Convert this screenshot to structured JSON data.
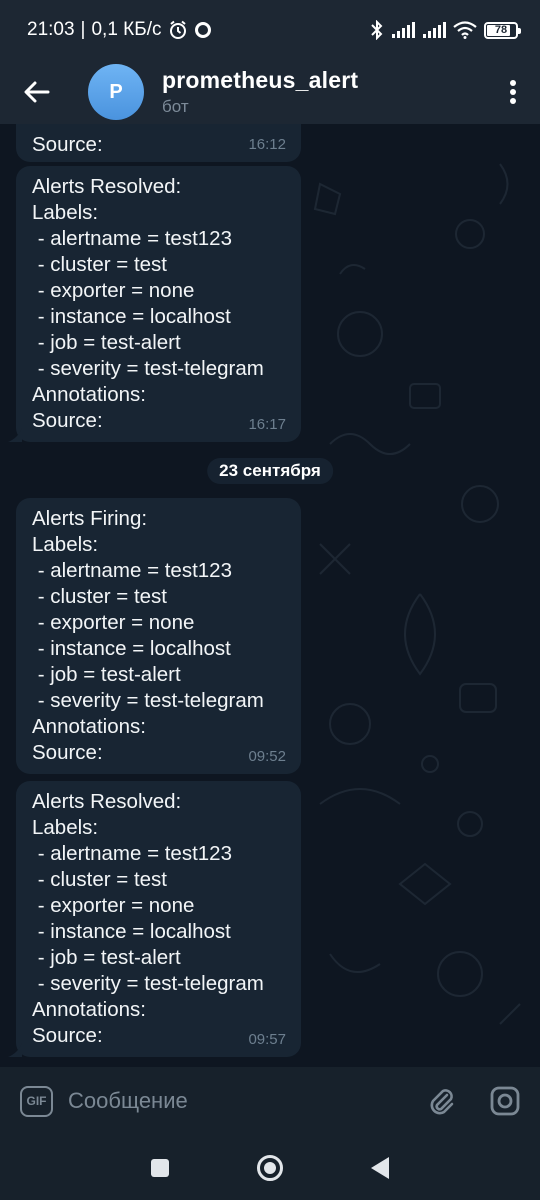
{
  "status_bar": {
    "time": "21:03",
    "network_speed": "0,1 КБ/с",
    "battery_level": "78",
    "icons": [
      "alarm-icon",
      "circle-notification-icon",
      "bluetooth-icon",
      "signal-icon",
      "signal-icon",
      "wifi-icon",
      "battery-icon"
    ]
  },
  "header": {
    "avatar_letter": "P",
    "title": "prometheus_alert",
    "subtitle": "бот"
  },
  "messages": [
    {
      "lines": [
        "Source:"
      ],
      "time": "16:12"
    },
    {
      "lines": [
        "Alerts Resolved:",
        "Labels:",
        " - alertname = test123",
        " - cluster = test",
        " - exporter = none",
        " - instance = localhost",
        " - job = test-alert",
        " - severity = test-telegram",
        "Annotations:",
        "Source:"
      ],
      "time": "16:17"
    },
    {
      "lines": [
        "Alerts Firing:",
        "Labels:",
        " - alertname = test123",
        " - cluster = test",
        " - exporter = none",
        " - instance = localhost",
        " - job = test-alert",
        " - severity = test-telegram",
        "Annotations:",
        "Source:"
      ],
      "time": "09:52"
    },
    {
      "lines": [
        "Alerts Resolved:",
        "Labels:",
        " - alertname = test123",
        " - cluster = test",
        " - exporter = none",
        " - instance = localhost",
        " - job = test-alert",
        " - severity = test-telegram",
        "Annotations:",
        "Source:"
      ],
      "time": "09:57"
    }
  ],
  "date_separator": "23 сентября",
  "input": {
    "gif_label": "GIF",
    "placeholder": "Сообщение"
  },
  "colors": {
    "header_bg": "#1d2733",
    "chat_bg": "#0e1621",
    "bubble_bg": "#182533",
    "avatar": "#5aa4ec",
    "time_text": "#6d7f8f"
  }
}
